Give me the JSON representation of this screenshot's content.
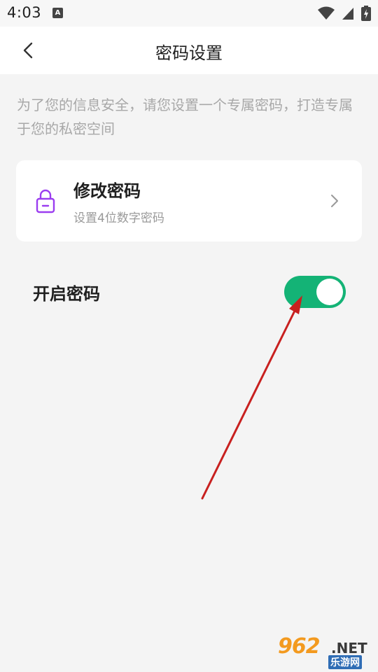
{
  "status_bar": {
    "time": "4:03",
    "notification_letter": "A",
    "icons": [
      "wifi-icon",
      "signal-icon",
      "battery-charging-icon"
    ]
  },
  "navbar": {
    "back_icon": "back-arrow-icon",
    "title": "密码设置"
  },
  "tip": "为了您的信息安全，请您设置一个专属密码，打造专属于您的私密空间",
  "change_password_card": {
    "icon": "lock-icon",
    "title": "修改密码",
    "subtitle": "设置4位数字密码",
    "chevron_icon": "chevron-right-icon"
  },
  "password_toggle": {
    "label": "开启密码",
    "enabled": true
  },
  "watermark": {
    "number": "962",
    "domain": ".NET",
    "site": "乐游网"
  },
  "colors": {
    "accent_green": "#14b376",
    "lock_purple": "#9b3df0",
    "annotation_red": "#c8201f",
    "background": "#f4f4f4"
  }
}
